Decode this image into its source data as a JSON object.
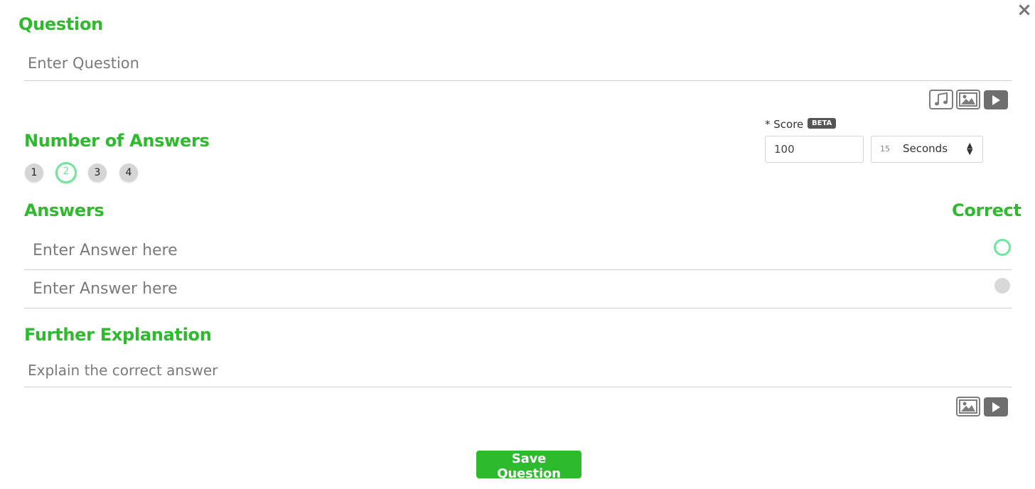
{
  "close_glyph": "×",
  "question": {
    "heading": "Question",
    "placeholder": "Enter Question"
  },
  "media_icons": [
    "music-icon",
    "image-icon",
    "video-play-icon"
  ],
  "number_of_answers": {
    "heading": "Number of Answers",
    "options": [
      "1",
      "2",
      "3",
      "4"
    ],
    "selected": "2"
  },
  "score": {
    "label": "* Score",
    "badge": "BETA",
    "value": "100",
    "time_value": "15",
    "time_unit": "Seconds"
  },
  "answers": {
    "heading": "Answers",
    "correct_heading": "Correct",
    "rows": [
      {
        "placeholder": "Enter Answer here",
        "correct": true
      },
      {
        "placeholder": "Enter Answer here",
        "correct": false
      }
    ]
  },
  "explanation": {
    "heading": "Further Explanation",
    "placeholder": "Explain the correct answer"
  },
  "explanation_media_icons": [
    "image-icon",
    "video-play-icon"
  ],
  "save_label": "Save Question",
  "colors": {
    "accent": "#2dbb2d",
    "selected_ring": "#6ee79c",
    "icon_gray": "#6e6e6e"
  }
}
